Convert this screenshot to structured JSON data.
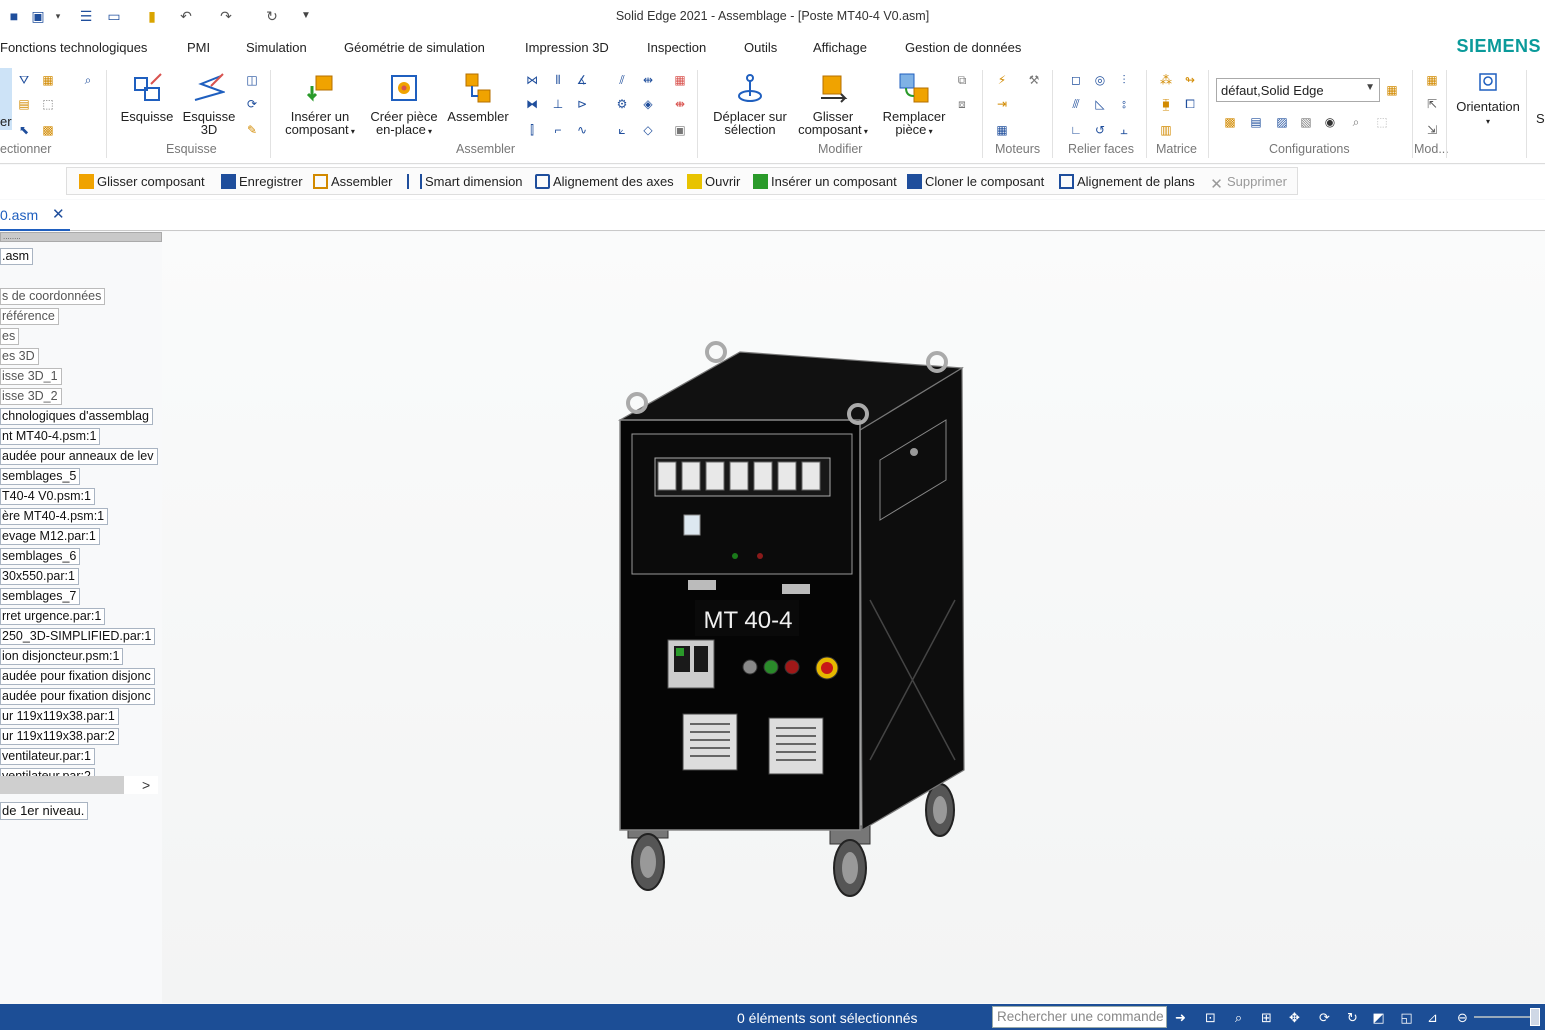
{
  "window": {
    "title": "Solid Edge 2021 - Assemblage - [Poste MT40-4 V0.asm]"
  },
  "menu": [
    "Fonctions technologiques",
    "PMI",
    "Simulation",
    "Géométrie de simulation",
    "Impression 3D",
    "Inspection",
    "Outils",
    "Affichage",
    "Gestion de données"
  ],
  "brand": "SIEMENS",
  "ribbon": {
    "groups": {
      "select": "ectionner",
      "esquisse": "Esquisse",
      "assembler": "Assembler",
      "modifier": "Modifier",
      "moteurs": "Moteurs",
      "relier": "Relier faces",
      "matrice": "Matrice",
      "configurations": "Configurations",
      "mod": "Mod..."
    },
    "buttons": {
      "select_partial": "er",
      "esquisse": "Esquisse",
      "esquisse3d_1": "Esquisse",
      "esquisse3d_2": "3D",
      "inserer_1": "Insérer un",
      "inserer_2": "composant",
      "creer_1": "Créer pièce",
      "creer_2": "en-place",
      "assembler": "Assembler",
      "deplacer_1": "Déplacer sur",
      "deplacer_2": "sélection",
      "glisser_1": "Glisser",
      "glisser_2": "composant",
      "remplacer_1": "Remplacer",
      "remplacer_2": "pièce",
      "orientation": "Orientation",
      "s_partial": "S"
    },
    "config_select": "défaut,Solid Edge"
  },
  "commandbar": [
    "Glisser composant",
    "Enregistrer",
    "Assembler",
    "Smart dimension",
    "Alignement des axes",
    "Ouvrir",
    "Insérer un composant",
    "Cloner le composant",
    "Alignement de plans",
    "Supprimer"
  ],
  "doc_tab": "0.asm",
  "tree": {
    "top": "........",
    "root": ".asm",
    "items": [
      "s de coordonnées",
      "référence",
      "es",
      "es 3D",
      "isse 3D_1",
      "isse 3D_2",
      "chnologiques d'assemblag",
      "nt MT40-4.psm:1",
      "audée pour anneaux de lev",
      "semblages_5",
      "T40-4 V0.psm:1",
      "ère MT40-4.psm:1",
      "evage M12.par:1",
      "semblages_6",
      "30x550.par:1",
      "semblages_7",
      "rret urgence.par:1",
      "250_3D-SIMPLIFIED.par:1",
      "ion disjoncteur.psm:1",
      "audée pour fixation disjonc",
      "audée pour fixation disjonc",
      "ur 119x119x38.par:1",
      "ur 119x119x38.par:2",
      "ventilateur.par:1",
      "ventilateur.par:2"
    ],
    "scroll_arrow": ">",
    "footer": "de 1er niveau."
  },
  "model": {
    "label": "MT 40-4"
  },
  "status": {
    "text": "0 éléments sont sélectionnés",
    "search_placeholder": "Rechercher une commande"
  }
}
